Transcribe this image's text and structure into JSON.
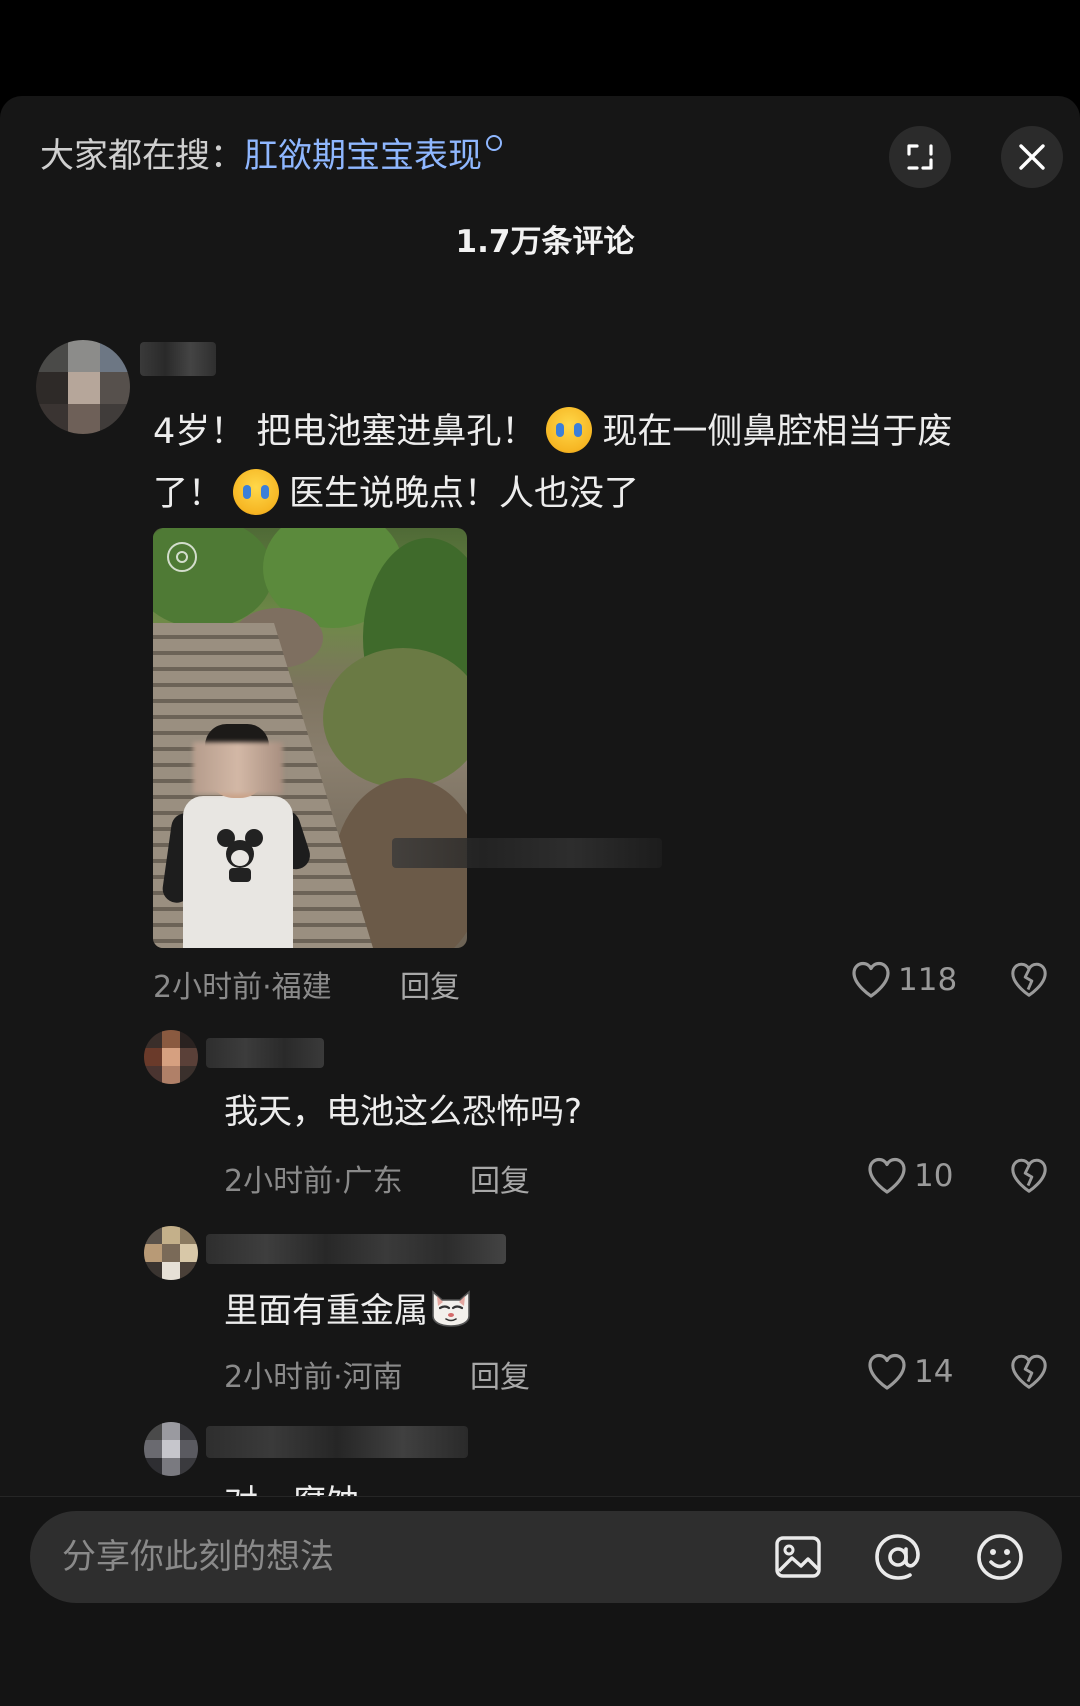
{
  "header": {
    "hot_search_prefix": "大家都在搜：",
    "hot_search_term": "肛欲期宝宝表现",
    "expand_icon": "expand-icon",
    "close_icon": "close-icon"
  },
  "comment_count_title": "1.7万条评论",
  "main_comment": {
    "text_line1_a": "4岁！ 把电池塞进鼻孔！",
    "text_line1_b": "现在一侧鼻腔相当于废",
    "text_line2_a": "了！",
    "text_line2_b": "医生说晚点！人也没了",
    "emoji_1": "loudly-crying-face",
    "emoji_2": "pleading-face",
    "time_location": "2小时前·福建",
    "reply_label": "回复",
    "likes": "118"
  },
  "replies": [
    {
      "text": "我天，电池这么恐怖吗?",
      "time_location": "2小时前·广东",
      "reply_label": "回复",
      "likes": "10"
    },
    {
      "text": "里面有重金属",
      "emoji": "cat-face",
      "time_location": "2小时前·河南",
      "reply_label": "回复",
      "likes": "14"
    }
  ],
  "cutoff_text": "对，腐蚀",
  "composer": {
    "placeholder": "分享你此刻的想法",
    "icons": [
      "image-icon",
      "at-icon",
      "emoji-icon"
    ]
  }
}
